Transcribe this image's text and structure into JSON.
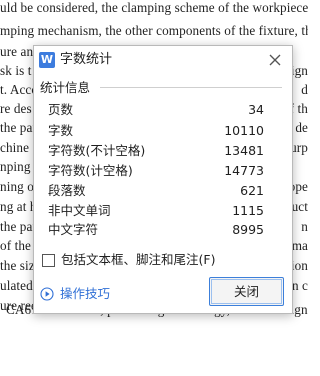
{
  "document": {
    "lines": [
      "uld be considered, the clamping scheme of the workpiece",
      "mping mechanism, the other components of the fixture, the st",
      "ure and",
      "sk is t",
      "t. Acco",
      "re des",
      "the par",
      "chine",
      "nping ac",
      "ning of",
      "ng at ho",
      "the par",
      "of the",
      "the size",
      "ulated",
      "ure req"
    ],
    "right_fragments": [
      "ign",
      "d",
      "of th",
      "e de",
      "urp",
      "ope",
      "uct",
      "n",
      "ma",
      "ion",
      "n c"
    ],
    "footer_line": "CA6140 tailstock, processing technology, fixture design,"
  },
  "dialog": {
    "title": "字数统计",
    "app_icon_letter": "W",
    "close_icon": "close-icon",
    "group_title": "统计信息",
    "stats": [
      {
        "label": "页数",
        "value": "34"
      },
      {
        "label": "字数",
        "value": "10110"
      },
      {
        "label": "字符数(不计空格)",
        "value": "13481"
      },
      {
        "label": "字符数(计空格)",
        "value": "14773"
      },
      {
        "label": "段落数",
        "value": "621"
      },
      {
        "label": "非中文单词",
        "value": "1115"
      },
      {
        "label": "中文字符",
        "value": "8995"
      }
    ],
    "checkbox_label": "包括文本框、脚注和尾注(F)",
    "checkbox_checked": false,
    "tips_label": "操作技巧",
    "close_button_label": "关闭",
    "colors": {
      "accent": "#3d7cde",
      "link": "#2f6fd6",
      "button_border": "#3c7fda"
    }
  }
}
